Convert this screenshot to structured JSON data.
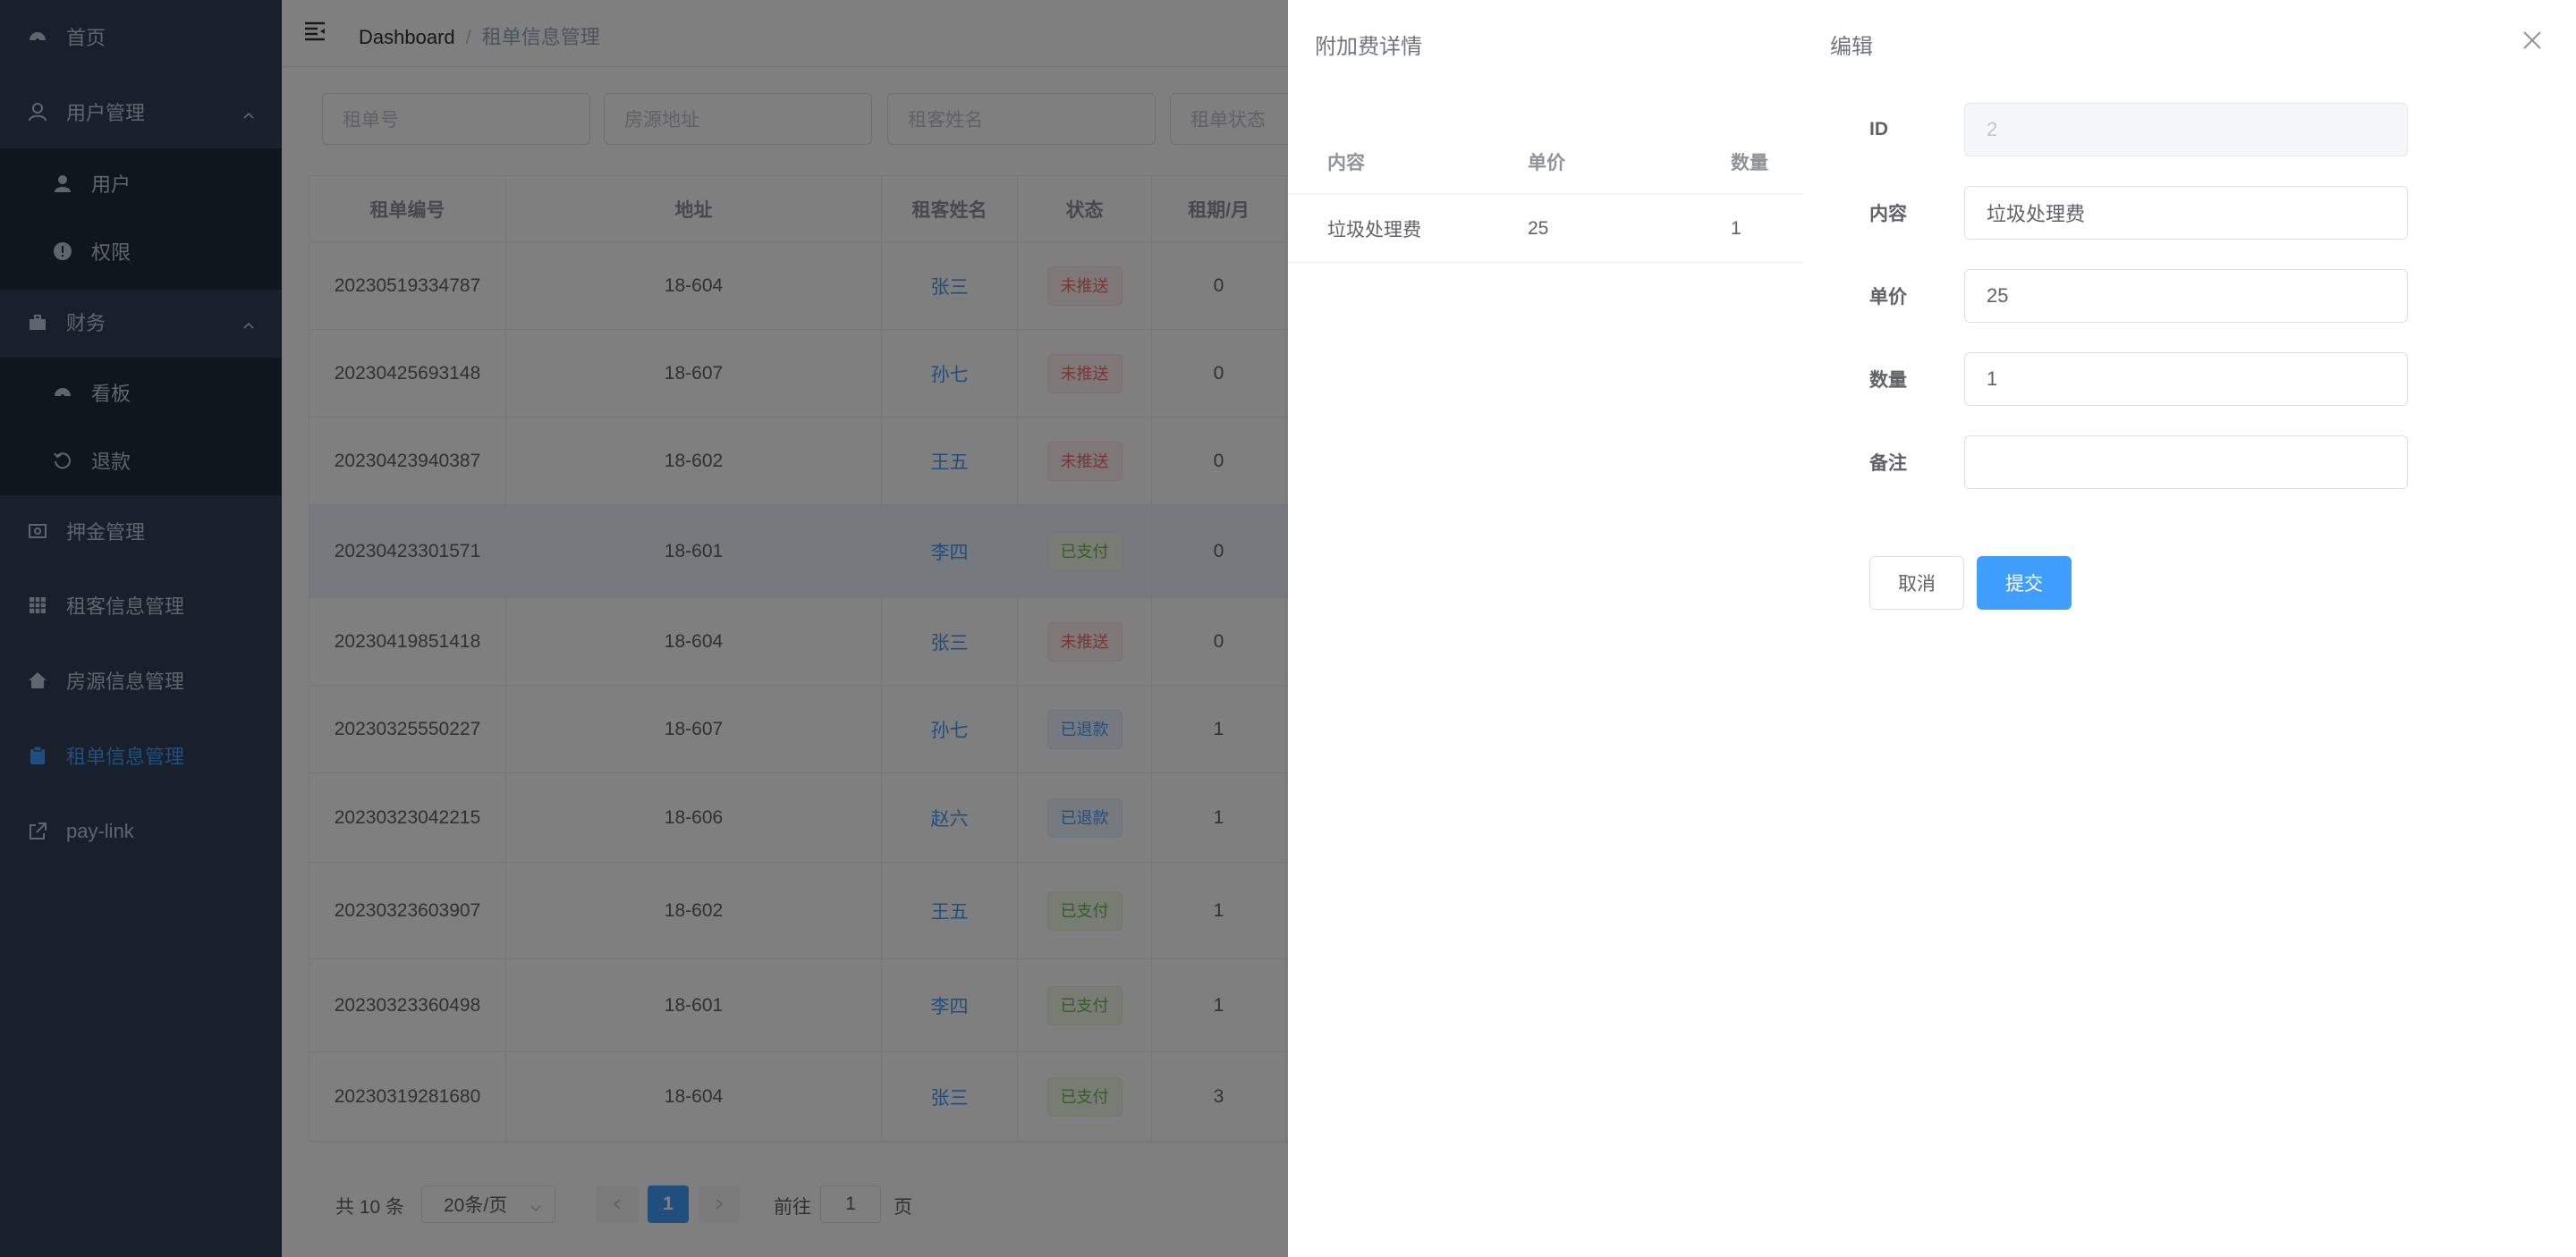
{
  "sidebar": {
    "items": [
      {
        "label": "首页",
        "icon": "dashboard-icon"
      },
      {
        "label": "用户管理",
        "icon": "user-icon"
      },
      {
        "label": "用户",
        "icon": "user-filled-icon"
      },
      {
        "label": "权限",
        "icon": "warning-circle-icon"
      },
      {
        "label": "财务",
        "icon": "briefcase-icon"
      },
      {
        "label": "看板",
        "icon": "gauge-icon"
      },
      {
        "label": "退款",
        "icon": "refresh-icon"
      },
      {
        "label": "押金管理",
        "icon": "money-icon"
      },
      {
        "label": "租客信息管理",
        "icon": "grid-icon"
      },
      {
        "label": "房源信息管理",
        "icon": "house-icon"
      },
      {
        "label": "租单信息管理",
        "icon": "clipboard-icon"
      },
      {
        "label": "pay-link",
        "icon": "external-link-icon"
      }
    ],
    "active_color": "#409eff"
  },
  "navbar": {
    "breadcrumb_home": "Dashboard",
    "breadcrumb_separator": "/",
    "breadcrumb_current": "租单信息管理"
  },
  "filters": {
    "order_no_placeholder": "租单号",
    "address_placeholder": "房源地址",
    "tenant_placeholder": "租客姓名",
    "status_placeholder": "租单状态"
  },
  "table": {
    "headers": [
      "租单编号",
      "地址",
      "租客姓名",
      "状态",
      "租期/月"
    ],
    "rows": [
      {
        "id": "20230519334787",
        "addr": "18-604",
        "name": "张三",
        "status": "未推送",
        "type": "danger",
        "months": "0"
      },
      {
        "id": "20230425693148",
        "addr": "18-607",
        "name": "孙七",
        "status": "未推送",
        "type": "danger",
        "months": "0"
      },
      {
        "id": "20230423940387",
        "addr": "18-602",
        "name": "王五",
        "status": "未推送",
        "type": "danger",
        "months": "0"
      },
      {
        "id": "20230423301571",
        "addr": "18-601",
        "name": "李四",
        "status": "已支付",
        "type": "success",
        "months": "0"
      },
      {
        "id": "20230419851418",
        "addr": "18-604",
        "name": "张三",
        "status": "未推送",
        "type": "danger",
        "months": "0"
      },
      {
        "id": "20230325550227",
        "addr": "18-607",
        "name": "孙七",
        "status": "已退款",
        "type": "info",
        "months": "1"
      },
      {
        "id": "20230323042215",
        "addr": "18-606",
        "name": "赵六",
        "status": "已退款",
        "type": "info",
        "months": "1"
      },
      {
        "id": "20230323603907",
        "addr": "18-602",
        "name": "王五",
        "status": "已支付",
        "type": "success",
        "months": "1"
      },
      {
        "id": "20230323360498",
        "addr": "18-601",
        "name": "李四",
        "status": "已支付",
        "type": "success",
        "months": "1"
      },
      {
        "id": "20230319281680",
        "addr": "18-604",
        "name": "张三",
        "status": "已支付",
        "type": "success",
        "months": "3"
      }
    ]
  },
  "pagination": {
    "total": "共 10 条",
    "page_size": "20条/页",
    "current_page": "1",
    "goto_prefix": "前往",
    "goto_value": "1",
    "goto_suffix": "页"
  },
  "fee_drawer": {
    "title": "附加费详情",
    "headers": [
      "内容",
      "单价",
      "数量"
    ],
    "rows": [
      {
        "content": "垃圾处理费",
        "price": "25",
        "qty": "1"
      }
    ]
  },
  "edit_drawer": {
    "title": "编辑",
    "id_label": "ID",
    "id_value": "2",
    "content_label": "内容",
    "content_value": "垃圾处理费",
    "price_label": "单价",
    "price_value": "25",
    "qty_label": "数量",
    "qty_value": "1",
    "remark_label": "备注",
    "remark_value": "",
    "cancel_label": "取消",
    "submit_label": "提交"
  },
  "colors": {
    "sidebar_bg": "#304156",
    "primary": "#409eff",
    "danger": "#f56c6c",
    "success": "#67c23a"
  }
}
